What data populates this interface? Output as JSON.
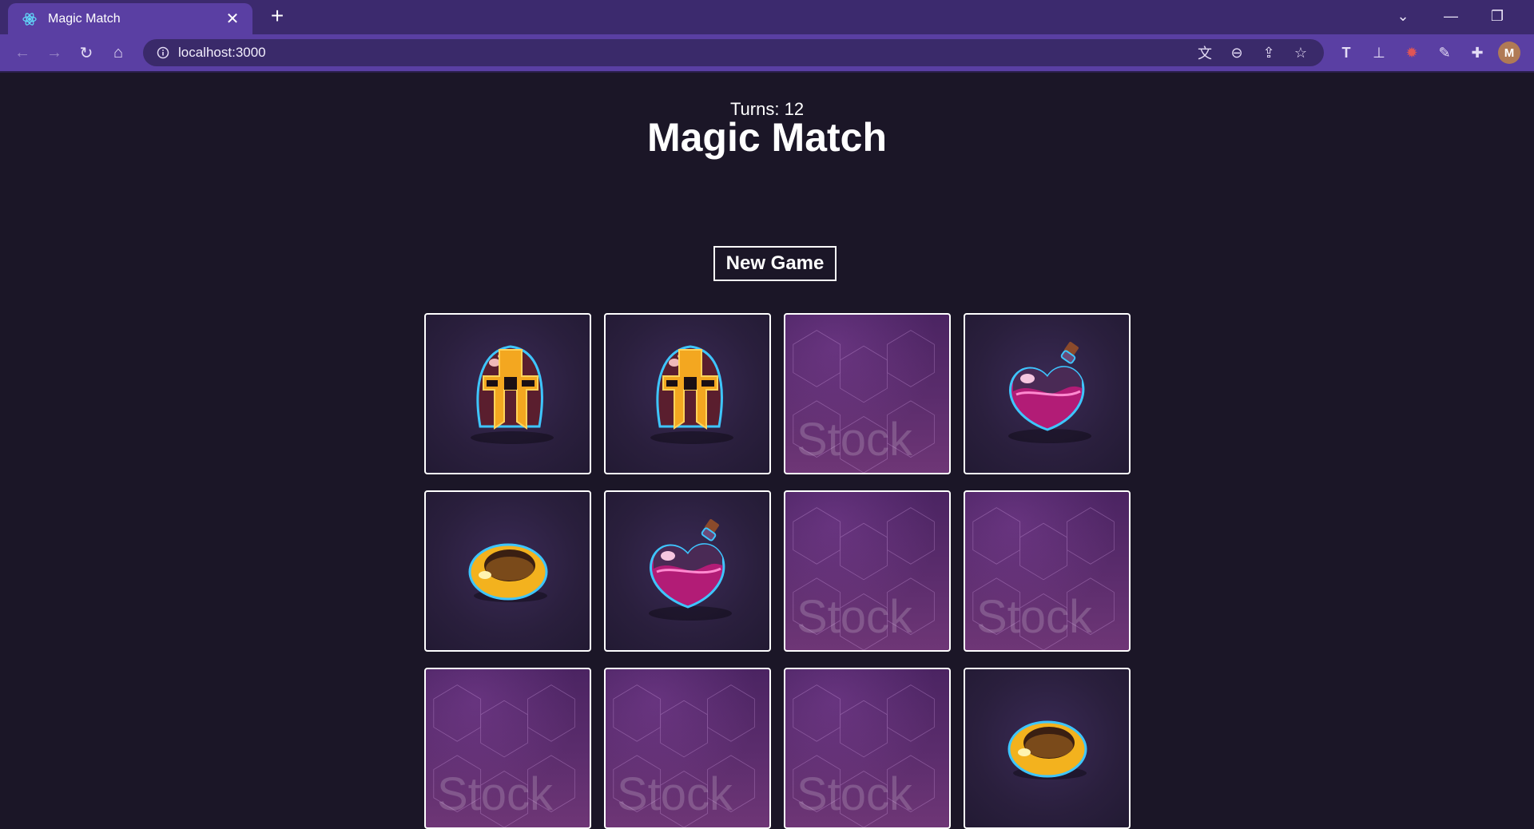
{
  "browser": {
    "tab_title": "Magic Match",
    "url": "localhost:3000",
    "avatar_letter": "M"
  },
  "game": {
    "title": "Magic Match",
    "new_game_label": "New Game",
    "turns_label": "Turns: 12",
    "cards": [
      {
        "state": "face-up",
        "item": "helmet"
      },
      {
        "state": "face-up",
        "item": "helmet"
      },
      {
        "state": "face-down",
        "item": ""
      },
      {
        "state": "face-up",
        "item": "potion"
      },
      {
        "state": "face-up",
        "item": "ring"
      },
      {
        "state": "face-up",
        "item": "potion"
      },
      {
        "state": "face-down",
        "item": ""
      },
      {
        "state": "face-down",
        "item": ""
      },
      {
        "state": "face-down",
        "item": ""
      },
      {
        "state": "face-down",
        "item": ""
      },
      {
        "state": "face-down",
        "item": ""
      },
      {
        "state": "face-up",
        "item": "ring"
      }
    ],
    "card_back_watermark": "Stock"
  },
  "icons": {
    "favicon": "react-icon",
    "back": "arrow-left-icon",
    "forward": "arrow-right-icon",
    "reload": "reload-icon",
    "home": "home-icon",
    "info": "info-icon",
    "translate": "translate-icon",
    "zoom": "zoom-out-icon",
    "share": "share-icon",
    "bookmark": "star-icon",
    "extensions": "puzzle-icon"
  },
  "colors": {
    "page_bg": "#1b1627",
    "browser_frame": "#5a3fa3",
    "card_back": "#5a2c6c",
    "card_front": "#2a1f3d"
  }
}
